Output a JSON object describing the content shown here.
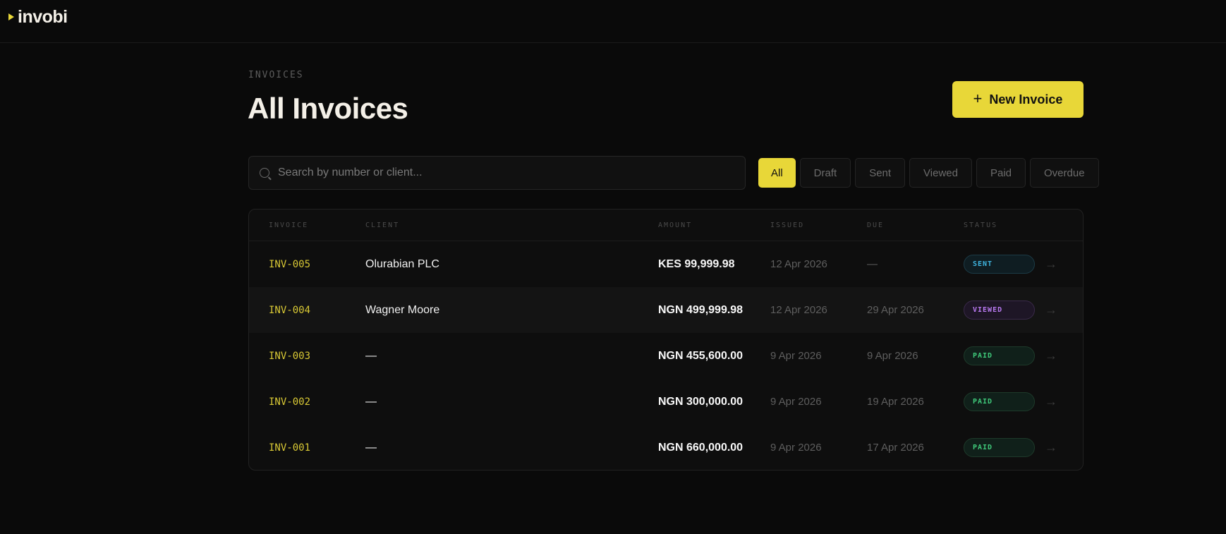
{
  "app": {
    "logo_text": "invobi"
  },
  "header": {
    "eyebrow": "INVOICES",
    "title": "All Invoices",
    "new_button_label": "New Invoice",
    "new_button_icon": "+"
  },
  "search": {
    "placeholder": "Search by number or client...",
    "value": ""
  },
  "filters": [
    {
      "label": "All",
      "active": true
    },
    {
      "label": "Draft",
      "active": false
    },
    {
      "label": "Sent",
      "active": false
    },
    {
      "label": "Viewed",
      "active": false
    },
    {
      "label": "Paid",
      "active": false
    },
    {
      "label": "Overdue",
      "active": false
    }
  ],
  "table": {
    "columns": [
      "INVOICE",
      "CLIENT",
      "AMOUNT",
      "ISSUED",
      "DUE",
      "STATUS"
    ],
    "rows": [
      {
        "invoice": "INV-005",
        "client": "Olurabian PLC",
        "amount": "KES 99,999.98",
        "issued": "12 Apr 2026",
        "due": "—",
        "status": "SENT",
        "arrow": "→"
      },
      {
        "invoice": "INV-004",
        "client": "Wagner Moore",
        "amount": "NGN 499,999.98",
        "issued": "12 Apr 2026",
        "due": "29 Apr 2026",
        "status": "VIEWED",
        "arrow": "→"
      },
      {
        "invoice": "INV-003",
        "client": "—",
        "amount": "NGN 455,600.00",
        "issued": "9 Apr 2026",
        "due": "9 Apr 2026",
        "status": "PAID",
        "arrow": "→"
      },
      {
        "invoice": "INV-002",
        "client": "—",
        "amount": "NGN 300,000.00",
        "issued": "9 Apr 2026",
        "due": "19 Apr 2026",
        "status": "PAID",
        "arrow": "→"
      },
      {
        "invoice": "INV-001",
        "client": "—",
        "amount": "NGN 660,000.00",
        "issued": "9 Apr 2026",
        "due": "17 Apr 2026",
        "status": "PAID",
        "arrow": "→"
      }
    ]
  },
  "colors": {
    "accent": "#e8d738",
    "background": "#0a0a0a",
    "status_sent": "#3fb5e0",
    "status_viewed": "#b879f0",
    "status_paid": "#3fc97a"
  },
  "icons": {
    "logo": "play-triangle-icon",
    "search": "search-icon",
    "add": "plus-icon",
    "row_open": "arrow-right-icon"
  }
}
